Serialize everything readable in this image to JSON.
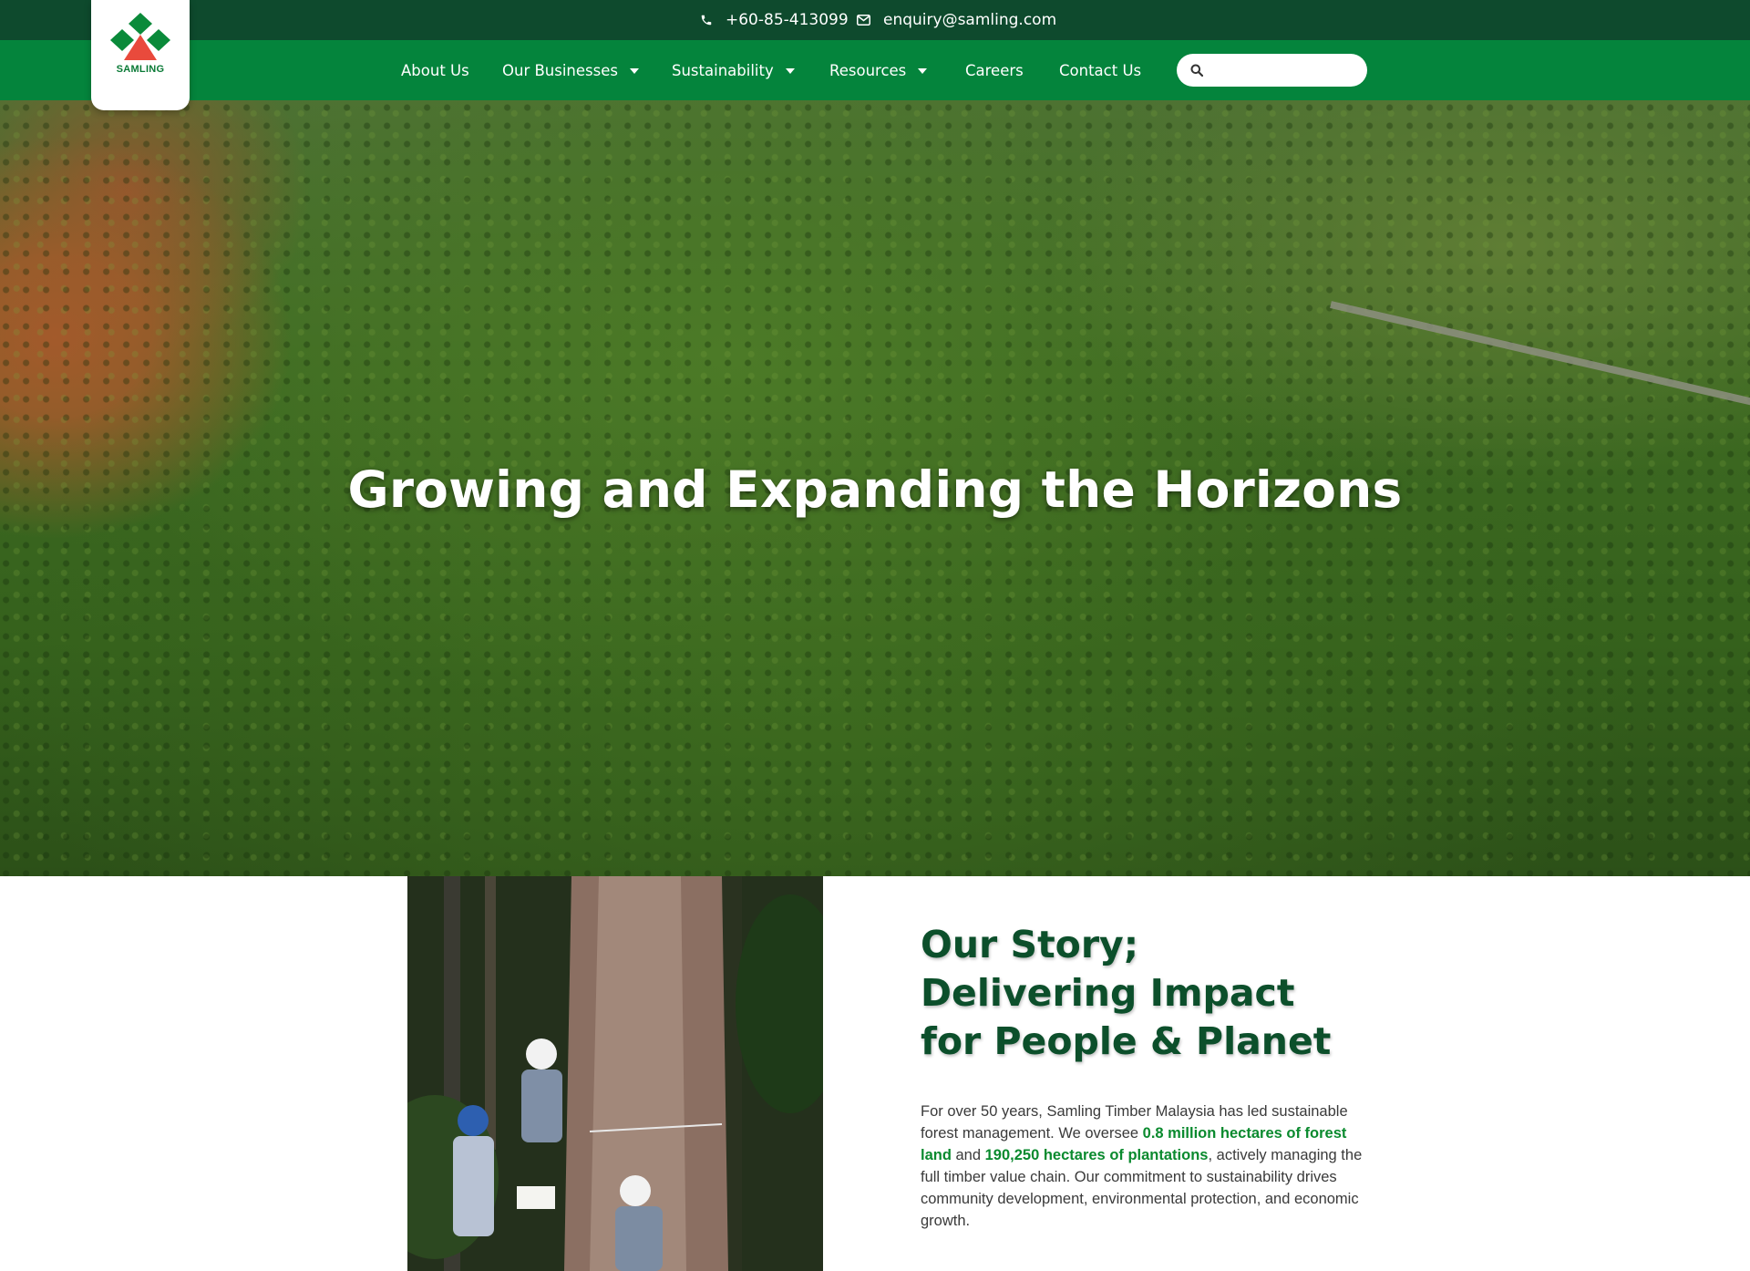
{
  "brand": {
    "logo_text": "SAMLING",
    "primary_green": "#04843c",
    "dark_green": "#0e4a2d",
    "accent_red": "#e94a3c"
  },
  "topbar": {
    "phone": "+60-85-413099",
    "email": "enquiry@samling.com",
    "phone_icon": "phone-icon",
    "email_icon": "envelope-icon"
  },
  "nav": {
    "items": [
      {
        "label": "About Us",
        "dropdown": false
      },
      {
        "label": "Our Businesses",
        "dropdown": true
      },
      {
        "label": "Sustainability",
        "dropdown": true
      },
      {
        "label": "Resources",
        "dropdown": true
      },
      {
        "label": "Careers",
        "dropdown": false
      },
      {
        "label": "Contact Us",
        "dropdown": false
      }
    ],
    "search": {
      "placeholder": "",
      "icon": "search-icon"
    }
  },
  "hero": {
    "title": "Growing and Expanding the Horizons"
  },
  "story": {
    "title_line1": "Our Story;",
    "title_line2": "Delivering Impact",
    "title_line3": "for People & Planet",
    "text_part1": "For over 50 years, Samling Timber Malaysia has led sustainable forest management. We oversee ",
    "highlight1": "0.8 million hectares of forest land",
    "text_part2": " and ",
    "highlight2": "190,250 hectares of plantations",
    "text_part3": ", actively managing the full timber value chain. Our commitment to sustainability drives community development, environmental protection, and economic growth."
  }
}
